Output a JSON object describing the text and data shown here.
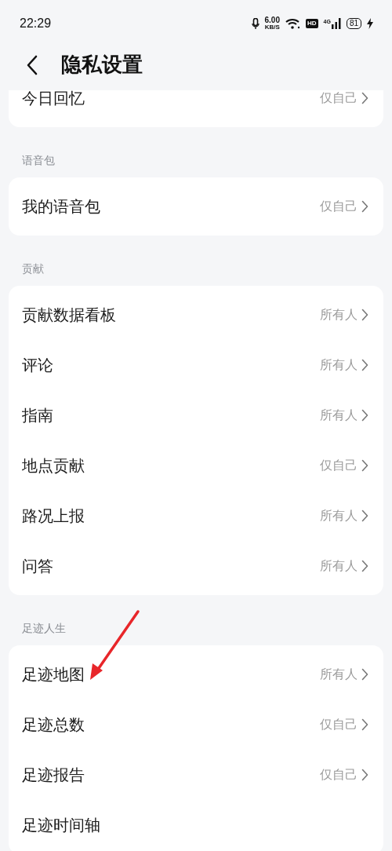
{
  "status_bar": {
    "time": "22:29",
    "net_speed": "6.00",
    "net_unit": "KB/S",
    "hd": "HD",
    "network": "4G",
    "battery": "81"
  },
  "header": {
    "title": "隐私设置"
  },
  "sections": [
    {
      "rows": [
        {
          "label": "今日回忆",
          "value": "仅自己"
        }
      ]
    },
    {
      "title": "语音包",
      "rows": [
        {
          "label": "我的语音包",
          "value": "仅自己"
        }
      ]
    },
    {
      "title": "贡献",
      "rows": [
        {
          "label": "贡献数据看板",
          "value": "所有人"
        },
        {
          "label": "评论",
          "value": "所有人"
        },
        {
          "label": "指南",
          "value": "所有人"
        },
        {
          "label": "地点贡献",
          "value": "仅自己"
        },
        {
          "label": "路况上报",
          "value": "所有人"
        },
        {
          "label": "问答",
          "value": "所有人"
        }
      ]
    },
    {
      "title": "足迹人生",
      "rows": [
        {
          "label": "足迹地图",
          "value": "所有人"
        },
        {
          "label": "足迹总数",
          "value": "仅自己"
        },
        {
          "label": "足迹报告",
          "value": "仅自己"
        },
        {
          "label": "足迹时间轴"
        }
      ]
    }
  ]
}
